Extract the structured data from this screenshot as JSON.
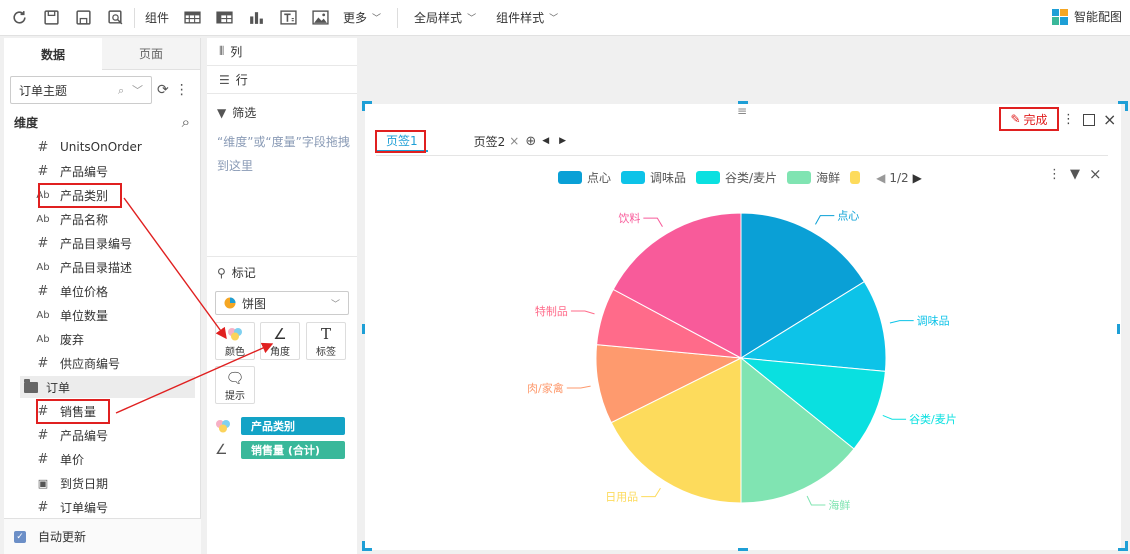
{
  "toolbar": {
    "component_label": "组件",
    "more_label": "更多",
    "global_style_label": "全局样式",
    "component_style_label": "组件样式",
    "smart_chart_label": "智能配图"
  },
  "left_panel": {
    "tabs": [
      "数据",
      "页面"
    ],
    "subject_select": "订单主题",
    "dimension_label": "维度",
    "fields": [
      {
        "type": "#",
        "name": "UnitsOnOrder"
      },
      {
        "type": "#",
        "name": "产品编号"
      },
      {
        "type": "Ab",
        "name": "产品类别"
      },
      {
        "type": "Ab",
        "name": "产品名称"
      },
      {
        "type": "#",
        "name": "产品目录编号"
      },
      {
        "type": "Ab",
        "name": "产品目录描述"
      },
      {
        "type": "#",
        "name": "单位价格"
      },
      {
        "type": "Ab",
        "name": "单位数量"
      },
      {
        "type": "Ab",
        "name": "废弃"
      },
      {
        "type": "#",
        "name": "供应商编号"
      }
    ],
    "folder_label": "订单",
    "order_fields": [
      {
        "type": "#",
        "name": "销售量"
      },
      {
        "type": "#",
        "name": "产品编号"
      },
      {
        "type": "#",
        "name": "单价"
      },
      {
        "type": "date",
        "name": "到货日期"
      },
      {
        "type": "#",
        "name": "订单编号"
      }
    ],
    "auto_update_label": "自动更新"
  },
  "mid_panel": {
    "columns_label": "列",
    "rows_label": "行",
    "filter_label": "筛选",
    "filter_hint": "“维度”或“度量”字段拖拽到这里",
    "marks_label": "标记",
    "chart_type": "饼图",
    "mark_buttons": {
      "color": "颜色",
      "angle": "角度",
      "label": "标签",
      "tooltip": "提示"
    },
    "pills": {
      "color_field": "产品类别",
      "angle_field": "销售量 (合计)"
    },
    "pill_colors": {
      "color_field": "#13a3c6",
      "angle_field": "#3ab89a"
    }
  },
  "widget": {
    "tabs": [
      "页签1",
      "页签2"
    ],
    "done_label": "完成",
    "legend_page": "1/2"
  },
  "chart_data": {
    "type": "pie",
    "categories": [
      "点心",
      "调味品",
      "谷类/麦片",
      "海鲜",
      "日用品",
      "肉/家禽",
      "特制品",
      "饮料"
    ],
    "values": [
      16.5,
      10.5,
      9.5,
      14.5,
      18.0,
      9.0,
      6.5,
      17.5
    ],
    "colors": [
      "#0aa0d6",
      "#0dc3e8",
      "#0ae0e0",
      "#80e4b2",
      "#fddb5c",
      "#fe9a6e",
      "#ff6b8a",
      "#f85b9a"
    ],
    "legend": [
      "点心",
      "调味品",
      "谷类/麦片",
      "海鲜"
    ],
    "legend_placement": "top"
  }
}
